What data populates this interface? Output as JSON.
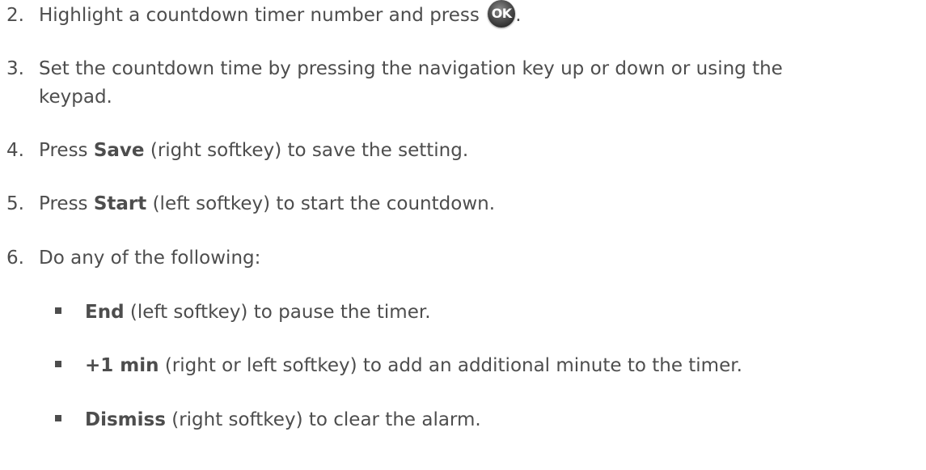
{
  "steps": [
    {
      "num": "2.",
      "before": "Highlight a countdown timer number and press",
      "icon": "ok-button-icon",
      "icon_label": "OK",
      "after": "."
    },
    {
      "num": "3.",
      "line1": "Set the countdown time by pressing the navigation key up or down or using the",
      "line2": "keypad."
    },
    {
      "num": "4.",
      "lead": "Press ",
      "bold": "Save",
      "rest": " (right softkey) to save the setting."
    },
    {
      "num": "5.",
      "lead": "Press ",
      "bold": "Start",
      "rest": " (left softkey) to start the countdown."
    },
    {
      "num": "6.",
      "text": "Do any of the following:"
    }
  ],
  "bullets": [
    {
      "bold": "End",
      "rest": " (left softkey) to pause the timer."
    },
    {
      "bold": "+1 min",
      "rest": " (right or left softkey) to add an additional minute to the timer."
    },
    {
      "bold": "Dismiss",
      "rest": " (right softkey) to clear the alarm."
    }
  ]
}
